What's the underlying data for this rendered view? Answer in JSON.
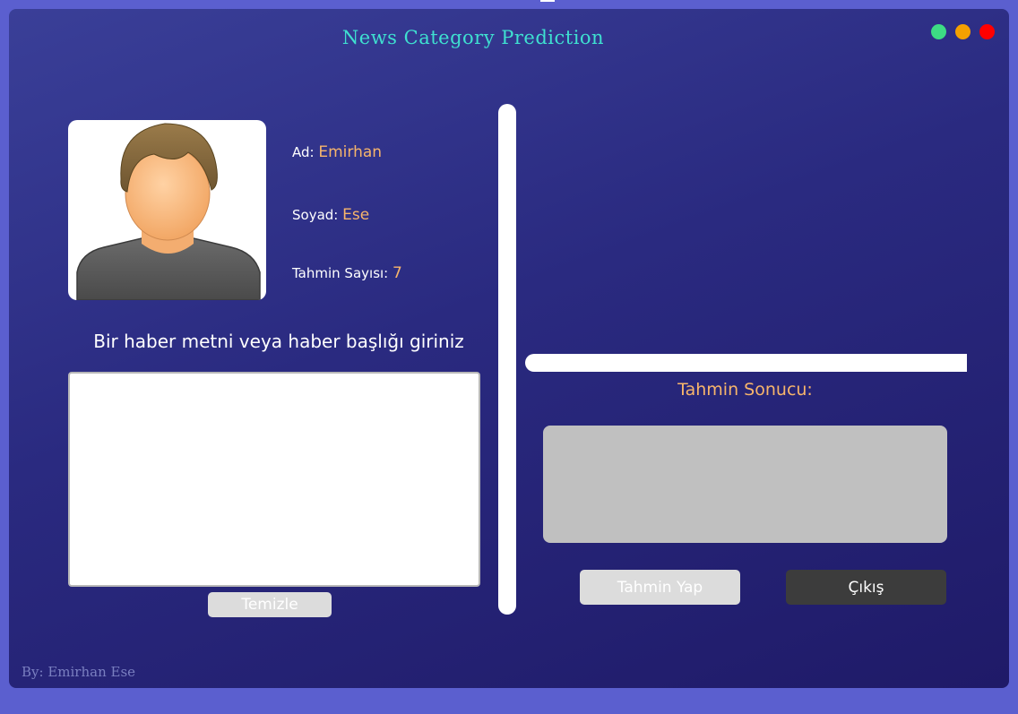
{
  "window": {
    "title": "News Category Prediction",
    "controls": {
      "green": "#3ddc84",
      "orange": "#f5a000",
      "red": "#ff0000"
    }
  },
  "profile": {
    "avatar_icon": "user-avatar-icon",
    "ad_label": "Ad:",
    "ad_value": "Emirhan",
    "soyad_label": "Soyad:",
    "soyad_value": "Ese",
    "tahmin_label": "Tahmin Sayısı:",
    "tahmin_value": "7"
  },
  "input": {
    "prompt": "Bir haber metni veya haber başlığı giriniz",
    "value": "",
    "clear_label": "Temizle"
  },
  "result": {
    "label": "Tahmin Sonucu:",
    "value": ""
  },
  "actions": {
    "predict_label": "Tahmin Yap",
    "exit_label": "Çıkış"
  },
  "footer": {
    "credit": "By: Emirhan Ese"
  },
  "colors": {
    "accent_title": "#3fe0d0",
    "value_orange": "#f7b56b",
    "background": "#2a2a80"
  }
}
